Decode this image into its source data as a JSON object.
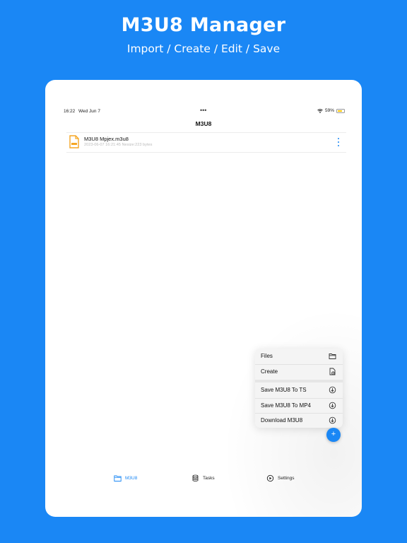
{
  "banner": {
    "title": "M3U8 Manager",
    "subtitle": "Import / Create / Edit / Save"
  },
  "status_bar": {
    "time": "16:22",
    "date": "Wed Jun 7",
    "battery": "59%",
    "battery_level": 0.59
  },
  "nav": {
    "title": "M3U8"
  },
  "files": [
    {
      "name": "M3U8 Mpjex.m3u8",
      "meta": "2023-06-07 16:21:45 Nesize:223 bytes"
    }
  ],
  "menu": {
    "items": [
      {
        "label": "Files",
        "icon": "folder-icon"
      },
      {
        "label": "Create",
        "icon": "new-file-icon"
      },
      {
        "label": "Save M3U8 To TS",
        "icon": "download-circle-icon"
      },
      {
        "label": "Save M3U8 To MP4",
        "icon": "download-circle-icon"
      },
      {
        "label": "Download M3U8",
        "icon": "download-circle-icon"
      }
    ]
  },
  "fab": {
    "icon": "plus-icon",
    "label": "+"
  },
  "tabs": [
    {
      "label": "M3U8",
      "icon": "folder-icon",
      "active": true
    },
    {
      "label": "Tasks",
      "icon": "database-icon",
      "active": false
    },
    {
      "label": "Settings",
      "icon": "play-circle-icon",
      "active": false
    }
  ],
  "colors": {
    "accent": "#1a87f5",
    "background": "#1a87f5",
    "file_icon": "#f5a623"
  }
}
